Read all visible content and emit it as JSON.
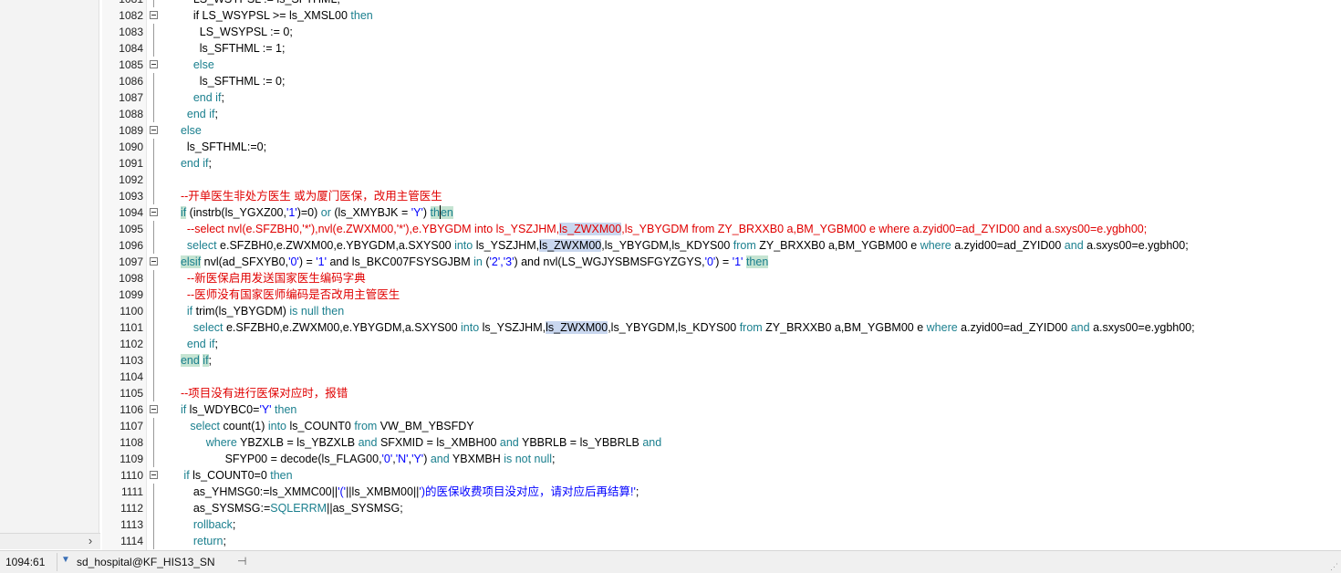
{
  "status": {
    "position": "1094:61",
    "connection": "sd_hospital@KF_HIS13_SN"
  },
  "lines": [
    {
      "n": "1081",
      "segs": [
        {
          "t": "      LS_WSYPSL := ls_SFTHML;",
          "c": ""
        }
      ]
    },
    {
      "n": "1082",
      "segs": [
        {
          "t": "      if LS_WSYPSL >= ls_XMSL00 ",
          "c": ""
        },
        {
          "t": "then",
          "c": "kw2"
        }
      ]
    },
    {
      "n": "1083",
      "segs": [
        {
          "t": "        LS_WSYPSL := 0;",
          "c": ""
        }
      ]
    },
    {
      "n": "1084",
      "segs": [
        {
          "t": "        ls_SFTHML := 1;",
          "c": ""
        }
      ]
    },
    {
      "n": "1085",
      "segs": [
        {
          "t": "      else",
          "c": "kw2"
        }
      ]
    },
    {
      "n": "1086",
      "segs": [
        {
          "t": "        ls_SFTHML := 0;",
          "c": ""
        }
      ]
    },
    {
      "n": "1087",
      "segs": [
        {
          "t": "      ",
          "c": ""
        },
        {
          "t": "end if",
          "c": "kw2"
        },
        {
          "t": ";",
          "c": ""
        }
      ]
    },
    {
      "n": "1088",
      "segs": [
        {
          "t": "    ",
          "c": ""
        },
        {
          "t": "end if",
          "c": "kw2"
        },
        {
          "t": ";",
          "c": ""
        }
      ]
    },
    {
      "n": "1089",
      "segs": [
        {
          "t": "  else",
          "c": "kw2"
        }
      ]
    },
    {
      "n": "1090",
      "segs": [
        {
          "t": "    ls_SFTHML:=0;",
          "c": ""
        }
      ]
    },
    {
      "n": "1091",
      "segs": [
        {
          "t": "  ",
          "c": ""
        },
        {
          "t": "end if",
          "c": "kw2"
        },
        {
          "t": ";",
          "c": ""
        }
      ]
    },
    {
      "n": "1092",
      "segs": [
        {
          "t": "",
          "c": ""
        }
      ]
    },
    {
      "n": "1093",
      "segs": [
        {
          "t": "  --开单医生非处方医生 或为厦门医保，改用主管医生",
          "c": "cmt"
        }
      ]
    },
    {
      "n": "1094",
      "segs": [
        {
          "t": "  ",
          "c": ""
        },
        {
          "t": "if",
          "c": "kw2 hlg"
        },
        {
          "t": " (instrb(ls_YGXZ00,",
          "c": ""
        },
        {
          "t": "'1'",
          "c": "str"
        },
        {
          "t": ")=0) ",
          "c": ""
        },
        {
          "t": "or",
          "c": "kw2"
        },
        {
          "t": " (ls_XMYBJK = ",
          "c": ""
        },
        {
          "t": "'Y'",
          "c": "str"
        },
        {
          "t": ") ",
          "c": ""
        },
        {
          "t": "th",
          "c": "kw2 hlg"
        },
        {
          "t": "|",
          "c": "cursor"
        },
        {
          "t": "en",
          "c": "kw2 hlg"
        }
      ]
    },
    {
      "n": "1095",
      "segs": [
        {
          "t": "    --select nvl(e.SFZBH0,'*'),nvl(e.ZWXM00,'*'),e.YBYGDM into ls_YSZJHM,",
          "c": "cmt"
        },
        {
          "t": "ls_ZWXM00",
          "c": "cmt hlb"
        },
        {
          "t": ",ls_YBYGDM from ZY_BRXXB0 a,BM_YGBM00 e where a.zyid00=ad_ZYID00 and a.sxys00=e.ygbh00;",
          "c": "cmt"
        }
      ]
    },
    {
      "n": "1096",
      "segs": [
        {
          "t": "    ",
          "c": ""
        },
        {
          "t": "select",
          "c": "kw2"
        },
        {
          "t": " e.SFZBH0,e.ZWXM00,e.YBYGDM,a.SXYS00 ",
          "c": ""
        },
        {
          "t": "into",
          "c": "kw2"
        },
        {
          "t": " ls_YSZJHM,",
          "c": ""
        },
        {
          "t": "ls_ZWXM00",
          "c": "hlb"
        },
        {
          "t": ",ls_YBYGDM,ls_KDYS00 ",
          "c": ""
        },
        {
          "t": "from",
          "c": "kw2"
        },
        {
          "t": " ZY_BRXXB0 a,BM_YGBM00 e ",
          "c": ""
        },
        {
          "t": "where",
          "c": "kw2"
        },
        {
          "t": " a.zyid00=ad_ZYID00 ",
          "c": ""
        },
        {
          "t": "and",
          "c": "kw2"
        },
        {
          "t": " a.sxys00=e.ygbh00;",
          "c": ""
        }
      ]
    },
    {
      "n": "1097",
      "segs": [
        {
          "t": "  ",
          "c": ""
        },
        {
          "t": "elsif",
          "c": "kw2 hlg"
        },
        {
          "t": " nvl(ad_SFXYB0,",
          "c": ""
        },
        {
          "t": "'0'",
          "c": "str"
        },
        {
          "t": ") = ",
          "c": ""
        },
        {
          "t": "'1'",
          "c": "str"
        },
        {
          "t": " and ls_BKC007FSYSGJBM ",
          "c": ""
        },
        {
          "t": "in",
          "c": "kw2"
        },
        {
          "t": " (",
          "c": ""
        },
        {
          "t": "'2','3'",
          "c": "str"
        },
        {
          "t": ") and nvl(LS_WGJYSBMSFGYZGYS,",
          "c": ""
        },
        {
          "t": "'0'",
          "c": "str"
        },
        {
          "t": ") = ",
          "c": ""
        },
        {
          "t": "'1'",
          "c": "str"
        },
        {
          "t": " ",
          "c": ""
        },
        {
          "t": "then",
          "c": "kw2 hlg"
        }
      ]
    },
    {
      "n": "1098",
      "segs": [
        {
          "t": "    --新医保启用发送国家医生编码字典",
          "c": "cmt"
        }
      ]
    },
    {
      "n": "1099",
      "segs": [
        {
          "t": "    --医师没有国家医师编码是否改用主管医生",
          "c": "cmt"
        }
      ]
    },
    {
      "n": "1100",
      "segs": [
        {
          "t": "    ",
          "c": ""
        },
        {
          "t": "if",
          "c": "kw2"
        },
        {
          "t": " trim(ls_YBYGDM) ",
          "c": ""
        },
        {
          "t": "is null then",
          "c": "kw2"
        }
      ]
    },
    {
      "n": "1101",
      "segs": [
        {
          "t": "      ",
          "c": ""
        },
        {
          "t": "select",
          "c": "kw2"
        },
        {
          "t": " e.SFZBH0,e.ZWXM00,e.YBYGDM,a.SXYS00 ",
          "c": ""
        },
        {
          "t": "into",
          "c": "kw2"
        },
        {
          "t": " ls_YSZJHM,",
          "c": ""
        },
        {
          "t": "ls_ZWXM00",
          "c": "hlb"
        },
        {
          "t": ",ls_YBYGDM,ls_KDYS00 ",
          "c": ""
        },
        {
          "t": "from",
          "c": "kw2"
        },
        {
          "t": " ZY_BRXXB0 a,BM_YGBM00 e ",
          "c": ""
        },
        {
          "t": "where",
          "c": "kw2"
        },
        {
          "t": " a.zyid00=ad_ZYID00 ",
          "c": ""
        },
        {
          "t": "and",
          "c": "kw2"
        },
        {
          "t": " a.sxys00=e.ygbh00;",
          "c": ""
        }
      ]
    },
    {
      "n": "1102",
      "segs": [
        {
          "t": "    ",
          "c": ""
        },
        {
          "t": "end if",
          "c": "kw2"
        },
        {
          "t": ";",
          "c": ""
        }
      ]
    },
    {
      "n": "1103",
      "segs": [
        {
          "t": "  ",
          "c": ""
        },
        {
          "t": "end",
          "c": "kw2 hlg"
        },
        {
          "t": " ",
          "c": ""
        },
        {
          "t": "if",
          "c": "kw2 hlg"
        },
        {
          "t": ";",
          "c": ""
        }
      ]
    },
    {
      "n": "1104",
      "segs": [
        {
          "t": "",
          "c": ""
        }
      ]
    },
    {
      "n": "1105",
      "segs": [
        {
          "t": "  --项目没有进行医保对应时，报错",
          "c": "cmt"
        }
      ]
    },
    {
      "n": "1106",
      "segs": [
        {
          "t": "  ",
          "c": ""
        },
        {
          "t": "if",
          "c": "kw2"
        },
        {
          "t": " ls_WDYBC0=",
          "c": ""
        },
        {
          "t": "'Y'",
          "c": "str"
        },
        {
          "t": " ",
          "c": ""
        },
        {
          "t": "then",
          "c": "kw2"
        }
      ]
    },
    {
      "n": "1107",
      "segs": [
        {
          "t": "     ",
          "c": ""
        },
        {
          "t": "select",
          "c": "kw2"
        },
        {
          "t": " count(1) ",
          "c": ""
        },
        {
          "t": "into",
          "c": "kw2"
        },
        {
          "t": " ls_COUNT0 ",
          "c": ""
        },
        {
          "t": "from",
          "c": "kw2"
        },
        {
          "t": " VW_BM_YBSFDY",
          "c": ""
        }
      ]
    },
    {
      "n": "1108",
      "segs": [
        {
          "t": "          ",
          "c": ""
        },
        {
          "t": "where",
          "c": "kw2"
        },
        {
          "t": " YBZXLB = ls_YBZXLB ",
          "c": ""
        },
        {
          "t": "and",
          "c": "kw2"
        },
        {
          "t": " SFXMID = ls_XMBH00 ",
          "c": ""
        },
        {
          "t": "and",
          "c": "kw2"
        },
        {
          "t": " YBBRLB = ls_YBBRLB ",
          "c": ""
        },
        {
          "t": "and",
          "c": "kw2"
        }
      ]
    },
    {
      "n": "1109",
      "segs": [
        {
          "t": "                SFYP00 = decode(ls_FLAG00,",
          "c": ""
        },
        {
          "t": "'0'",
          "c": "str"
        },
        {
          "t": ",",
          "c": ""
        },
        {
          "t": "'N'",
          "c": "str"
        },
        {
          "t": ",",
          "c": ""
        },
        {
          "t": "'Y'",
          "c": "str"
        },
        {
          "t": ") ",
          "c": ""
        },
        {
          "t": "and",
          "c": "kw2"
        },
        {
          "t": " YBXMBH ",
          "c": ""
        },
        {
          "t": "is not null",
          "c": "kw2"
        },
        {
          "t": ";",
          "c": ""
        }
      ]
    },
    {
      "n": "1110",
      "segs": [
        {
          "t": "   ",
          "c": ""
        },
        {
          "t": "if",
          "c": "kw2"
        },
        {
          "t": " ls_COUNT0=0 ",
          "c": ""
        },
        {
          "t": "then",
          "c": "kw2"
        }
      ]
    },
    {
      "n": "1111",
      "segs": [
        {
          "t": "      as_YHMSG0:=ls_XMMC00||",
          "c": ""
        },
        {
          "t": "'('",
          "c": "str"
        },
        {
          "t": "||ls_XMBM00||",
          "c": ""
        },
        {
          "t": "')的医保收费项目没对应，请对应后再结算!'",
          "c": "str"
        },
        {
          "t": ";",
          "c": ""
        }
      ]
    },
    {
      "n": "1112",
      "segs": [
        {
          "t": "      as_SYSMSG:=",
          "c": ""
        },
        {
          "t": "SQLERRM",
          "c": "kw2"
        },
        {
          "t": "||as_SYSMSG;",
          "c": ""
        }
      ]
    },
    {
      "n": "1113",
      "segs": [
        {
          "t": "      ",
          "c": ""
        },
        {
          "t": "rollback",
          "c": "kw2"
        },
        {
          "t": ";",
          "c": ""
        }
      ]
    },
    {
      "n": "1114",
      "segs": [
        {
          "t": "      ",
          "c": ""
        },
        {
          "t": "return",
          "c": "kw2"
        },
        {
          "t": ";",
          "c": ""
        }
      ]
    }
  ]
}
